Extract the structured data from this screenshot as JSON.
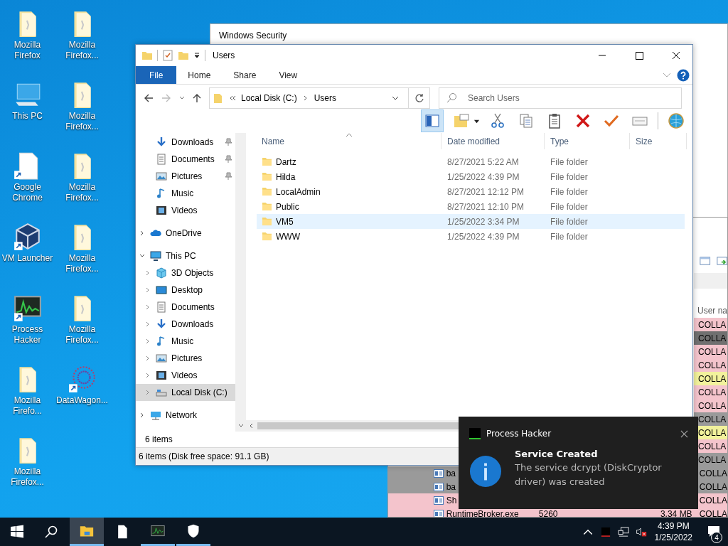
{
  "desktop_icons": [
    {
      "label": "Mozilla Firefox",
      "kind": "folder",
      "shortcut": false
    },
    {
      "label": "This PC",
      "kind": "pc",
      "shortcut": false
    },
    {
      "label": "Google Chrome",
      "kind": "page",
      "shortcut": true
    },
    {
      "label": "VM Launcher",
      "kind": "cube",
      "shortcut": true
    },
    {
      "label": "Process Hacker",
      "kind": "monitor",
      "shortcut": true
    },
    {
      "label": "Mozilla Firefo...",
      "kind": "folder",
      "shortcut": false
    },
    {
      "label": "Mozilla Firefox...",
      "kind": "folder",
      "shortcut": false
    },
    {
      "label": "Mozilla Firefox...",
      "kind": "folder",
      "shortcut": false
    },
    {
      "label": "Mozilla Firefox...",
      "kind": "folder",
      "shortcut": false
    },
    {
      "label": "Mozilla Firefox...",
      "kind": "folder",
      "shortcut": false
    },
    {
      "label": "Mozilla Firefox...",
      "kind": "folder",
      "shortcut": false
    },
    {
      "label": "Mozilla Firefox...",
      "kind": "folder",
      "shortcut": false
    },
    {
      "label": "DataWagon...",
      "kind": "star",
      "shortcut": true
    }
  ],
  "security_window": {
    "title": "Windows Security"
  },
  "process_window": {
    "user_column": "User na",
    "rows": [
      {
        "user": "COLLA",
        "color": "#f4c4cc"
      },
      {
        "user": "COLLA",
        "color": "#707070"
      },
      {
        "user": "COLLA",
        "color": "#f4c4cc"
      },
      {
        "user": "COLLA",
        "color": "#f4c4cc"
      },
      {
        "user": "COLLA",
        "color": "#f2f29c"
      },
      {
        "user": "COLLA",
        "color": "#f4c4cc"
      },
      {
        "user": "COLLA",
        "color": "#f4c4cc"
      },
      {
        "user": "COLLA",
        "color": "#9a9a9a"
      },
      {
        "user": "COLLA",
        "color": "#f2f29c"
      },
      {
        "user": "COLLA",
        "color": "#f4c4cc"
      },
      {
        "user": "COLLA",
        "color": "#9a9a9a"
      },
      {
        "name": "ba",
        "user": "COLLA",
        "color": "#9a9a9a"
      },
      {
        "name": "ba",
        "user": "COLLA",
        "color": "#9a9a9a"
      },
      {
        "name": "Sh",
        "user": "COLLA",
        "color": "#f4c4cc"
      },
      {
        "name": "RuntimeBroker.exe",
        "pid": "5260",
        "memory": "3.34 MB",
        "user": "COLLA",
        "color": "#f4c4cc"
      }
    ]
  },
  "explorer": {
    "title": "Users",
    "ribbon_tabs": [
      {
        "label": "File",
        "selected": true
      },
      {
        "label": "Home",
        "selected": false
      },
      {
        "label": "Share",
        "selected": false
      },
      {
        "label": "View",
        "selected": false
      }
    ],
    "address": [
      "Local Disk (C:)",
      "Users"
    ],
    "search": {
      "placeholder": "Search Users"
    },
    "quick_access": [
      {
        "label": "Downloads",
        "kind": "download",
        "pinned": true,
        "selected": false
      },
      {
        "label": "Documents",
        "kind": "document",
        "pinned": true,
        "selected": false
      },
      {
        "label": "Pictures",
        "kind": "picture",
        "pinned": true,
        "selected": false
      },
      {
        "label": "Music",
        "kind": "music",
        "pinned": false,
        "selected": false
      },
      {
        "label": "Videos",
        "kind": "video",
        "pinned": false,
        "selected": false
      }
    ],
    "tree": [
      {
        "label": "OneDrive",
        "kind": "cloud",
        "expanded": false,
        "selected": false
      },
      {
        "label": "This PC",
        "kind": "pc",
        "expanded": true,
        "selected": false,
        "children": [
          {
            "label": "3D Objects",
            "kind": "cube",
            "expanded": false,
            "selected": false
          },
          {
            "label": "Desktop",
            "kind": "desktop",
            "expanded": false,
            "selected": false
          },
          {
            "label": "Documents",
            "kind": "document",
            "expanded": false,
            "selected": false
          },
          {
            "label": "Downloads",
            "kind": "download",
            "expanded": false,
            "selected": false
          },
          {
            "label": "Music",
            "kind": "music",
            "expanded": false,
            "selected": false
          },
          {
            "label": "Pictures",
            "kind": "picture",
            "expanded": false,
            "selected": false
          },
          {
            "label": "Videos",
            "kind": "video",
            "expanded": false,
            "selected": false
          },
          {
            "label": "Local Disk (C:)",
            "kind": "drive",
            "expanded": false,
            "selected": true
          }
        ]
      },
      {
        "label": "Network",
        "kind": "network",
        "expanded": false,
        "selected": false
      }
    ],
    "columns": [
      "Name",
      "Date modified",
      "Type",
      "Size"
    ],
    "files": [
      {
        "name": "Dartz",
        "modified": "8/27/2021 5:22 AM",
        "type": "File folder",
        "selected": false
      },
      {
        "name": "Hilda",
        "modified": "1/25/2022 4:39 PM",
        "type": "File folder",
        "selected": false
      },
      {
        "name": "LocalAdmin",
        "modified": "8/27/2021 12:12 PM",
        "type": "File folder",
        "selected": false
      },
      {
        "name": "Public",
        "modified": "8/27/2021 12:10 PM",
        "type": "File folder",
        "selected": false
      },
      {
        "name": "VM5",
        "modified": "1/25/2022 3:34 PM",
        "type": "File folder",
        "selected": true
      },
      {
        "name": "WWW",
        "modified": "1/25/2022 4:39 PM",
        "type": "File folder",
        "selected": false
      }
    ],
    "item_count": "6 items",
    "status": "6 items (Disk free space: 91.1 GB)"
  },
  "notification": {
    "app": "Process Hacker",
    "title": "Service Created",
    "body": "The service dcrypt (DiskCryptor driver) was created"
  },
  "taskbar": {
    "apps": [
      {
        "kind": "explorer",
        "selected": true,
        "running": true
      },
      {
        "kind": "page",
        "selected": false,
        "running": false
      },
      {
        "kind": "monitor",
        "selected": false,
        "running": true
      },
      {
        "kind": "shield",
        "selected": false,
        "running": true
      }
    ],
    "volume_muted": true,
    "time": "4:39 PM",
    "date": "1/25/2022",
    "notification_count": "4"
  }
}
